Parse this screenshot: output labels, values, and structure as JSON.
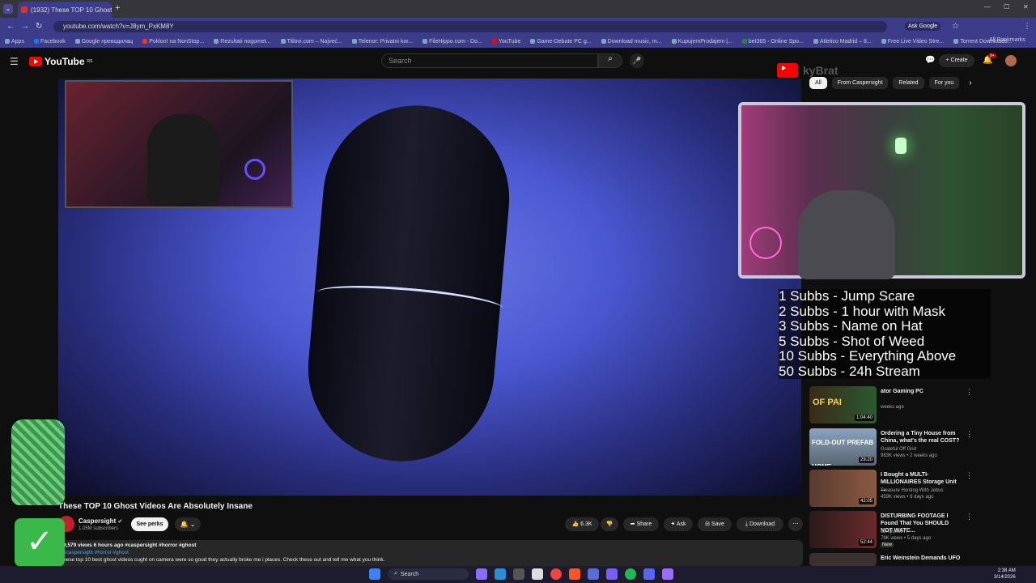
{
  "browser": {
    "tab_title": "(1932) These TOP 10 Ghost",
    "url": "youtube.com/watch?v=J8ym_PxKM8Y",
    "ask_google": "Ask Google",
    "apps_label": "Apps",
    "all_bookmarks": "All Bookmarks",
    "bookmarks": [
      "Facebook",
      "Google преводилац",
      "Poklon! na NonStop...",
      "Rezultati nogomet...",
      "Titlovi.com – Najveć...",
      "Telenor: Privatni kor...",
      "FileHippo.com - Do...",
      "YouTube",
      "Game-Debate PC g...",
      "Download music, m...",
      "KupujemProdajem |...",
      "bet365 - Online Spo...",
      "Atletico Madrid – 8...",
      "Free Live Video Stre...",
      "Torrent Downloads..."
    ]
  },
  "youtube": {
    "logo": "YouTube",
    "logo_sup": "RS",
    "search_placeholder": "Search",
    "create_label": "Create",
    "notif_count": "9+"
  },
  "chips": [
    "All",
    "From Caspersight",
    "Related",
    "For you"
  ],
  "overlay": {
    "watermark": "kyBrat",
    "lines": [
      "1 Subbs - Jump Scare",
      "2 Subbs - 1 hour with Mask",
      "3 Subbs - Name on Hat",
      "5 Subbs - Shot of Weed",
      "10 Subbs - Everything Above",
      "50 Subbs - 24h Stream"
    ]
  },
  "recommendations": [
    {
      "title": "ator Gaming PC",
      "meta1": "",
      "meta2": "weeks ago",
      "duration": "1:04:40",
      "thumb_text": "OF PAI"
    },
    {
      "title": "Ordering a Tiny House from China, what's the real COST?",
      "meta1": "Grateful Off Grid",
      "meta2": "983K views • 2 weeks ago",
      "duration": "29:20",
      "thumb_text": "FOLD-OUT PREFAB HOME"
    },
    {
      "title": "I Bought a MULTI-MILLIONAIRES Storage Unit ...",
      "meta1": "Treasure Hunting With Jebus",
      "meta2": "459K views • 9 days ago",
      "duration": "42:05",
      "thumb_text": ""
    },
    {
      "title": "DISTURBING FOOTAGE I Found That You SHOULD NOT WATC...",
      "meta1": "IamQuestHT",
      "meta2": "78K views • 5 days ago",
      "badge": "New",
      "duration": "52:44",
      "thumb_text": ""
    },
    {
      "title": "Eric Weinstein Demands UFO",
      "meta1": "",
      "meta2": "",
      "duration": "",
      "thumb_text": ""
    }
  ],
  "video": {
    "title": "These TOP 10 Ghost Videos Are Absolutely Insane",
    "channel": "Caspersight",
    "subscribers": "1.05M subscribers",
    "see_perks": "See perks",
    "likes": "6.3K",
    "share": "Share",
    "ask": "Ask",
    "save": "Save",
    "download": "Download",
    "views_line": "9,579 views  6 hours ago  #caspersight #horror #ghost",
    "tags": "#caspersight #horror #ghost",
    "description": "hese top 10 best ghost videos cught on camera were so good they actually broke me i places. Check these out and tell me what you think."
  },
  "taskbar": {
    "search": "Search",
    "time": "2:38 AM",
    "date": "3/14/2026"
  }
}
